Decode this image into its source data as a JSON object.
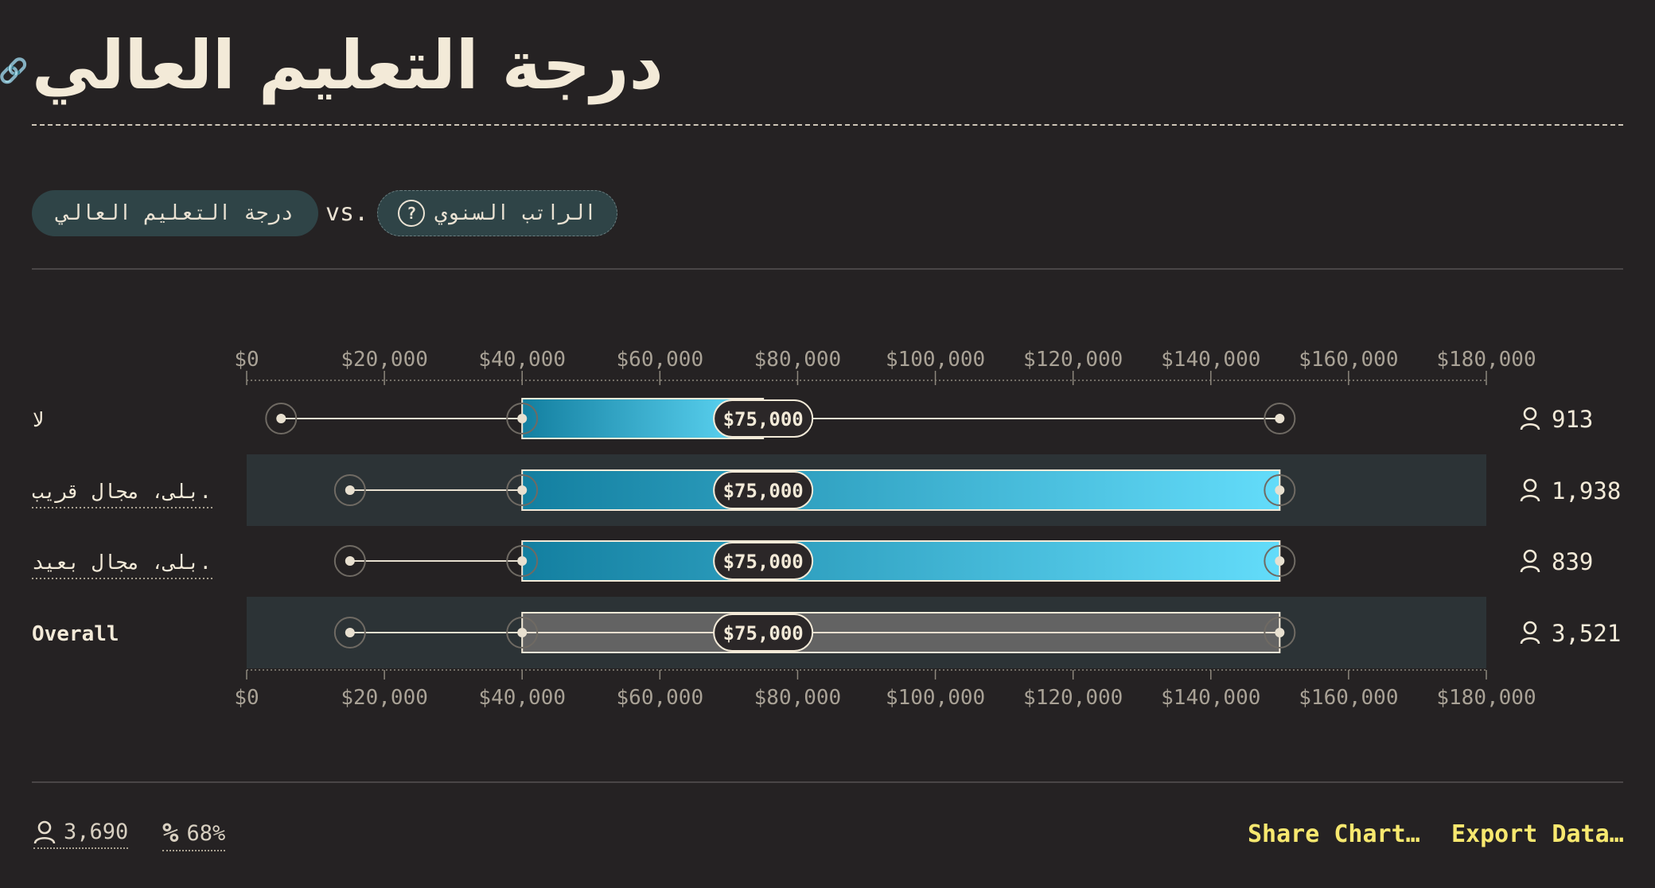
{
  "title": "درجة التعليم العالي",
  "filters": {
    "group_by": "درجة التعليم العالي",
    "vs": "vs.",
    "metric": "الراتب السنوي",
    "help_icon": "question-circle-icon",
    "link_icon": "link-icon"
  },
  "chart_data": {
    "type": "box",
    "xlim": [
      0,
      180000
    ],
    "ticks": [
      0,
      20000,
      40000,
      60000,
      80000,
      100000,
      120000,
      140000,
      160000,
      180000
    ],
    "tick_labels": [
      "$0",
      "$20,000",
      "$40,000",
      "$60,000",
      "$80,000",
      "$100,000",
      "$120,000",
      "$140,000",
      "$160,000",
      "$180,000"
    ],
    "series": [
      {
        "name": "لا",
        "min": 5000,
        "q1": 40000,
        "median": 75000,
        "q3": 75000,
        "max": 150000,
        "median_label": "$75,000",
        "count_label": "913",
        "underlined": false
      },
      {
        "name": "بلى، مجال قريب.",
        "min": 15000,
        "q1": 40000,
        "median": 75000,
        "q3": 150000,
        "max": 150000,
        "median_label": "$75,000",
        "count_label": "1,938",
        "underlined": true
      },
      {
        "name": "بلى، مجال بعيد.",
        "min": 15000,
        "q1": 40000,
        "median": 75000,
        "q3": 150000,
        "max": 150000,
        "median_label": "$75,000",
        "count_label": "839",
        "underlined": true
      },
      {
        "name": "Overall",
        "min": 15000,
        "q1": 40000,
        "median": 75000,
        "q3": 150000,
        "max": 150000,
        "median_label": "$75,000",
        "count_label": "3,521",
        "underlined": false,
        "overall": true
      }
    ],
    "colors": {
      "gradient_start": "#137fa0",
      "gradient_end": "#63dcfa",
      "overall_fill": "#636363",
      "band": "#2c3336",
      "text": "#f3ead8"
    }
  },
  "footer": {
    "respondents": "3,690",
    "percent": "68%",
    "user_icon": "user-icon",
    "percent_icon": "percent-icon",
    "share": "Share Chart…",
    "export": "Export Data…"
  }
}
